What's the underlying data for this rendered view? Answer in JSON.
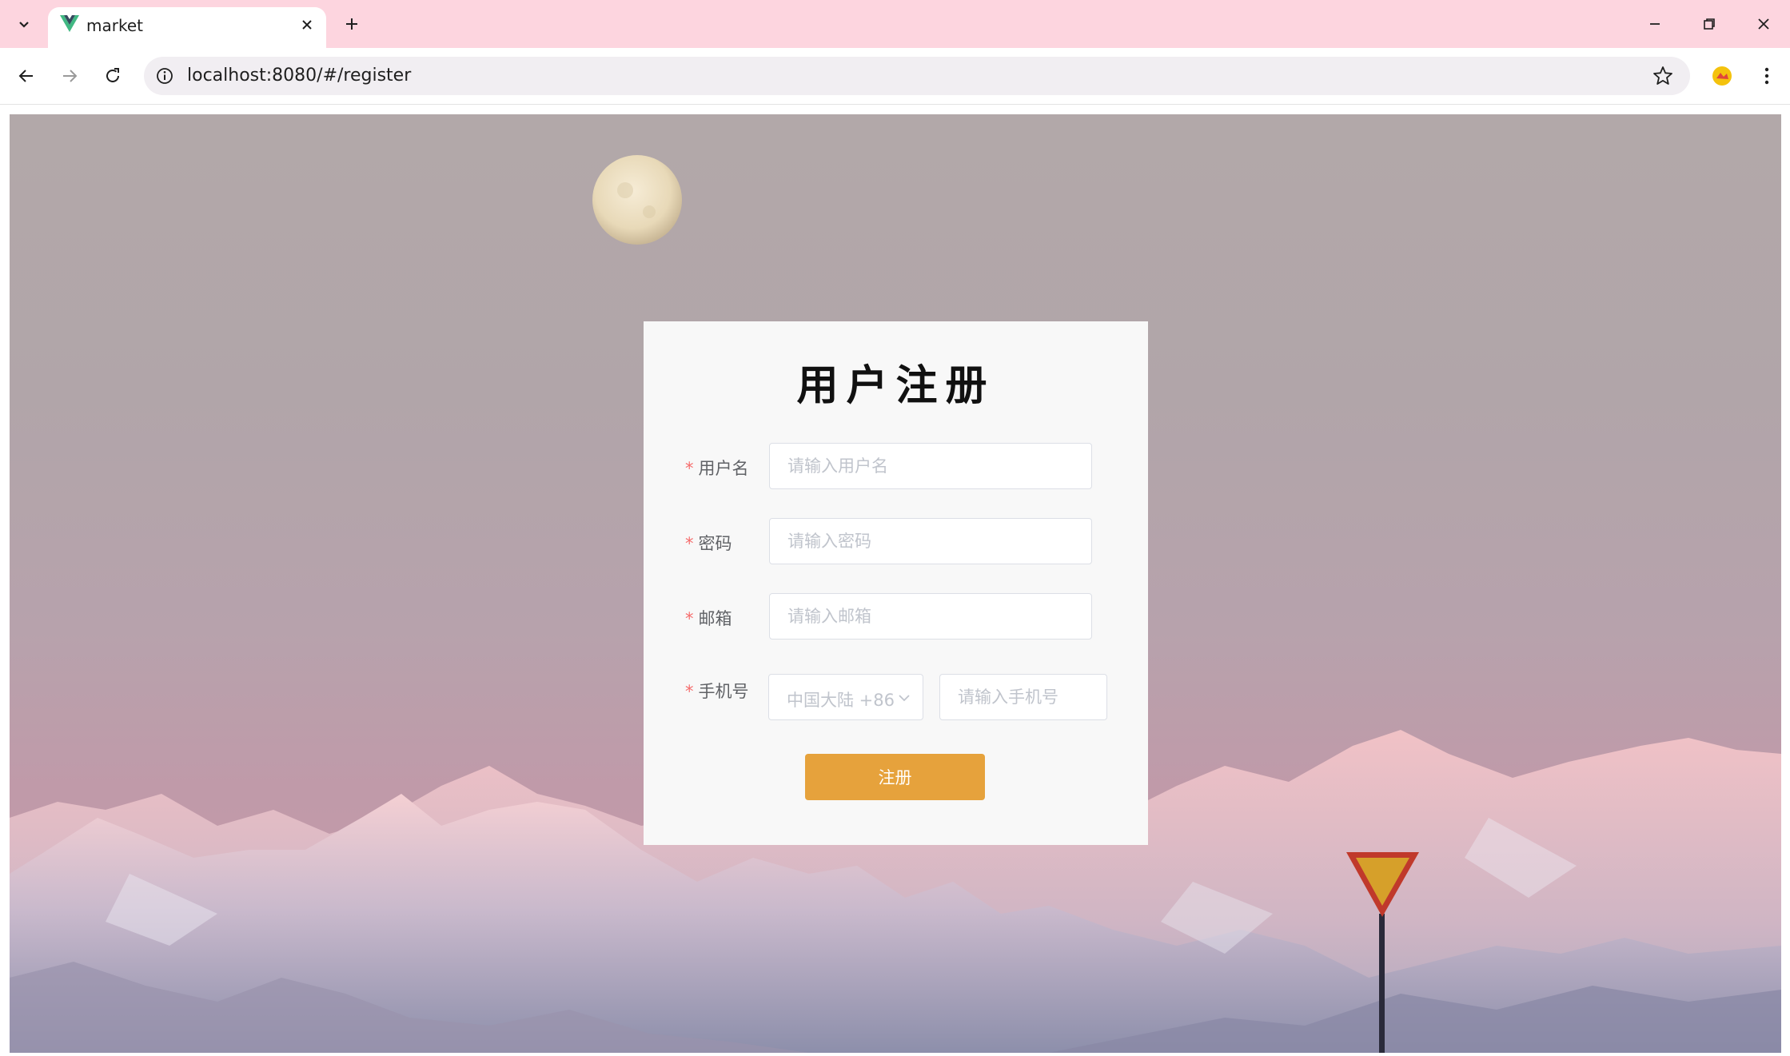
{
  "browser": {
    "tab_title": "market",
    "url": "localhost:8080/#/register"
  },
  "form": {
    "title": "用户注册",
    "required_mark": "*",
    "username": {
      "label": "用户名",
      "placeholder": "请输入用户名"
    },
    "password": {
      "label": "密码",
      "placeholder": "请输入密码"
    },
    "email": {
      "label": "邮箱",
      "placeholder": "请输入邮箱"
    },
    "phone": {
      "label": "手机号",
      "country_code": "中国大陆 +86",
      "placeholder": "请输入手机号"
    },
    "submit_label": "注册"
  },
  "colors": {
    "accent_button": "#e6a23c",
    "required_mark": "#f56c6c",
    "tab_strip": "#fdd5df"
  },
  "icons": {
    "tab_dropdown": "chevron-down-icon",
    "favicon": "vue-logo-icon",
    "tab_close": "close-icon",
    "new_tab": "plus-icon",
    "back": "arrow-left-icon",
    "forward": "arrow-right-icon",
    "reload": "reload-icon",
    "site_info": "info-icon",
    "bookmark": "star-icon",
    "extension": "extension-icon",
    "menu": "kebab-menu-icon",
    "select_arrow": "chevron-down-icon"
  }
}
